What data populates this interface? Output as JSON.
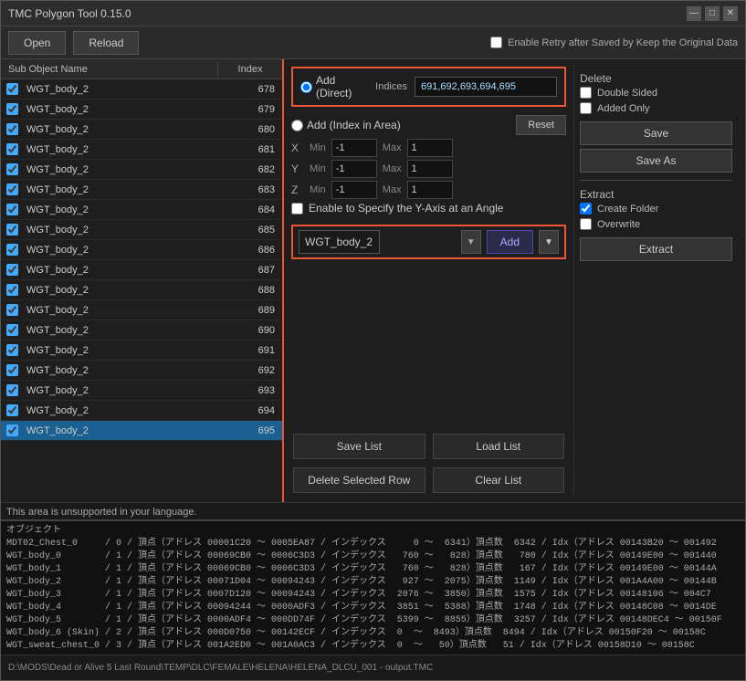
{
  "window": {
    "title": "TMC Polygon Tool 0.15.0",
    "controls": [
      "—",
      "□",
      "✕"
    ]
  },
  "toolbar": {
    "open_label": "Open",
    "reload_label": "Reload",
    "enable_retry_label": "Enable Retry after Saved by Keep the Original Data"
  },
  "table": {
    "col_name": "Sub Object Name",
    "col_index": "Index",
    "rows": [
      {
        "name": "WGT_body_2",
        "index": "678",
        "checked": true,
        "selected": false
      },
      {
        "name": "WGT_body_2",
        "index": "679",
        "checked": true,
        "selected": false
      },
      {
        "name": "WGT_body_2",
        "index": "680",
        "checked": true,
        "selected": false
      },
      {
        "name": "WGT_body_2",
        "index": "681",
        "checked": true,
        "selected": false
      },
      {
        "name": "WGT_body_2",
        "index": "682",
        "checked": true,
        "selected": false
      },
      {
        "name": "WGT_body_2",
        "index": "683",
        "checked": true,
        "selected": false
      },
      {
        "name": "WGT_body_2",
        "index": "684",
        "checked": true,
        "selected": false
      },
      {
        "name": "WGT_body_2",
        "index": "685",
        "checked": true,
        "selected": false
      },
      {
        "name": "WGT_body_2",
        "index": "686",
        "checked": true,
        "selected": false
      },
      {
        "name": "WGT_body_2",
        "index": "687",
        "checked": true,
        "selected": false
      },
      {
        "name": "WGT_body_2",
        "index": "688",
        "checked": true,
        "selected": false
      },
      {
        "name": "WGT_body_2",
        "index": "689",
        "checked": true,
        "selected": false
      },
      {
        "name": "WGT_body_2",
        "index": "690",
        "checked": true,
        "selected": false
      },
      {
        "name": "WGT_body_2",
        "index": "691",
        "checked": true,
        "selected": false
      },
      {
        "name": "WGT_body_2",
        "index": "692",
        "checked": true,
        "selected": false
      },
      {
        "name": "WGT_body_2",
        "index": "693",
        "checked": true,
        "selected": false
      },
      {
        "name": "WGT_body_2",
        "index": "694",
        "checked": true,
        "selected": false
      },
      {
        "name": "WGT_body_2",
        "index": "695",
        "checked": true,
        "selected": true
      }
    ]
  },
  "add_direct": {
    "radio_label": "Add (Direct)",
    "indices_label": "Indices",
    "indices_value": "691,692,693,694,695",
    "radio_selected": true
  },
  "add_area": {
    "radio_label": "Add (Index in Area)",
    "reset_label": "Reset",
    "x_min": "-1",
    "x_max": "1",
    "y_min": "-1",
    "y_max": "1",
    "z_min": "-1",
    "z_max": "1",
    "y_axis_label": "Enable to Specify the Y-Axis at an Angle"
  },
  "add_row": {
    "select_value": "WGT_body_2",
    "select_options": [
      "WGT_body_2"
    ],
    "add_label": "Add",
    "arrow_label": "▼"
  },
  "delete_section": {
    "title": "Delete",
    "double_sided_label": "Double Sided",
    "added_only_label": "Added Only",
    "save_label": "Save",
    "save_as_label": "Save As"
  },
  "extract_section": {
    "title": "Extract",
    "create_folder_label": "Create Folder",
    "overwrite_label": "Overwrite",
    "create_folder_checked": true,
    "overwrite_checked": false,
    "extract_label": "Extract"
  },
  "action_buttons": {
    "save_list": "Save List",
    "load_list": "Load List",
    "delete_selected": "Delete Selected Row",
    "clear_list": "Clear List"
  },
  "console": {
    "unsupported_msg": "This area is unsupported in your language.",
    "lines": [
      "オブジェクト",
      "MDT02_Chest_0     / 0 / 頂点（アドレス 00001C20 ～ 0005EA87 / インデックス     0 ～  6341）頂点数  6342 / Idx（アドレス 00143B20 ～ 001492",
      "WGT_body_0        / 1 / 頂点（アドレス 00069CB0 ～ 0006C3D3 / インデックス   760 ～   828）頂点数   780 / Idx（アドレス 00149E00 ～ 001440",
      "WGT_body_1        / 1 / 頂点（アドレス 00069CB0 ～ 0006C3D3 / インデックス   760 ～   828）頂点数   167 / Idx（アドレス 00149E00 ～ 00144A",
      "WGT_body_2        / 1 / 頂点（アドレス 00071D04 ～ 00094243 / インデックス   927 ～  2075）頂点数  1149 / Idx（アドレス 001A4A00 ～ 00144B",
      "WGT_body_3        / 1 / 頂点（アドレス 0007D120 ～ 00094243 / インデックス  2076 ～  3850）頂点数  1575 / Idx（アドレス 00148106 ～ 004C7",
      "WGT_body_4        / 1 / 頂点（アドレス 00094244 ～ 0000ADF3 / インデックス  3851 ～  5388）頂点数  1748 / Idx（アドレス 00148C08 ～ 0014DE",
      "WGT_body_5        / 1 / 頂点（アドレス 0000ADF4 ～ 000DD74F / インデックス  5399 ～  8855）頂点数  3257 / Idx（アドレス 00148DEC4 ～ 00150F",
      "WGT_body_6 (Skin) / 2 / 頂点（アドレス 000D0750 ～ 00142ECF / インデックス  0  ～  8493）頂点数  8494 / Idx（アドレス 00150F20 ～ 00158C",
      "WGT_sweat_chest_0 / 3 / 頂点（アドレス 001A2ED0 ～ 001A0AC3 / インデックス  0  ～   50）頂点数   51 / Idx（アドレス 00158D10 ～ 00158C"
    ]
  },
  "status_bar": {
    "path": "D:\\MODS\\Dead or Alive 5 Last Round\\TEMP\\DLC\\FEMALE\\HELENA\\HELENA_DLCU_001 - output.TMC"
  }
}
